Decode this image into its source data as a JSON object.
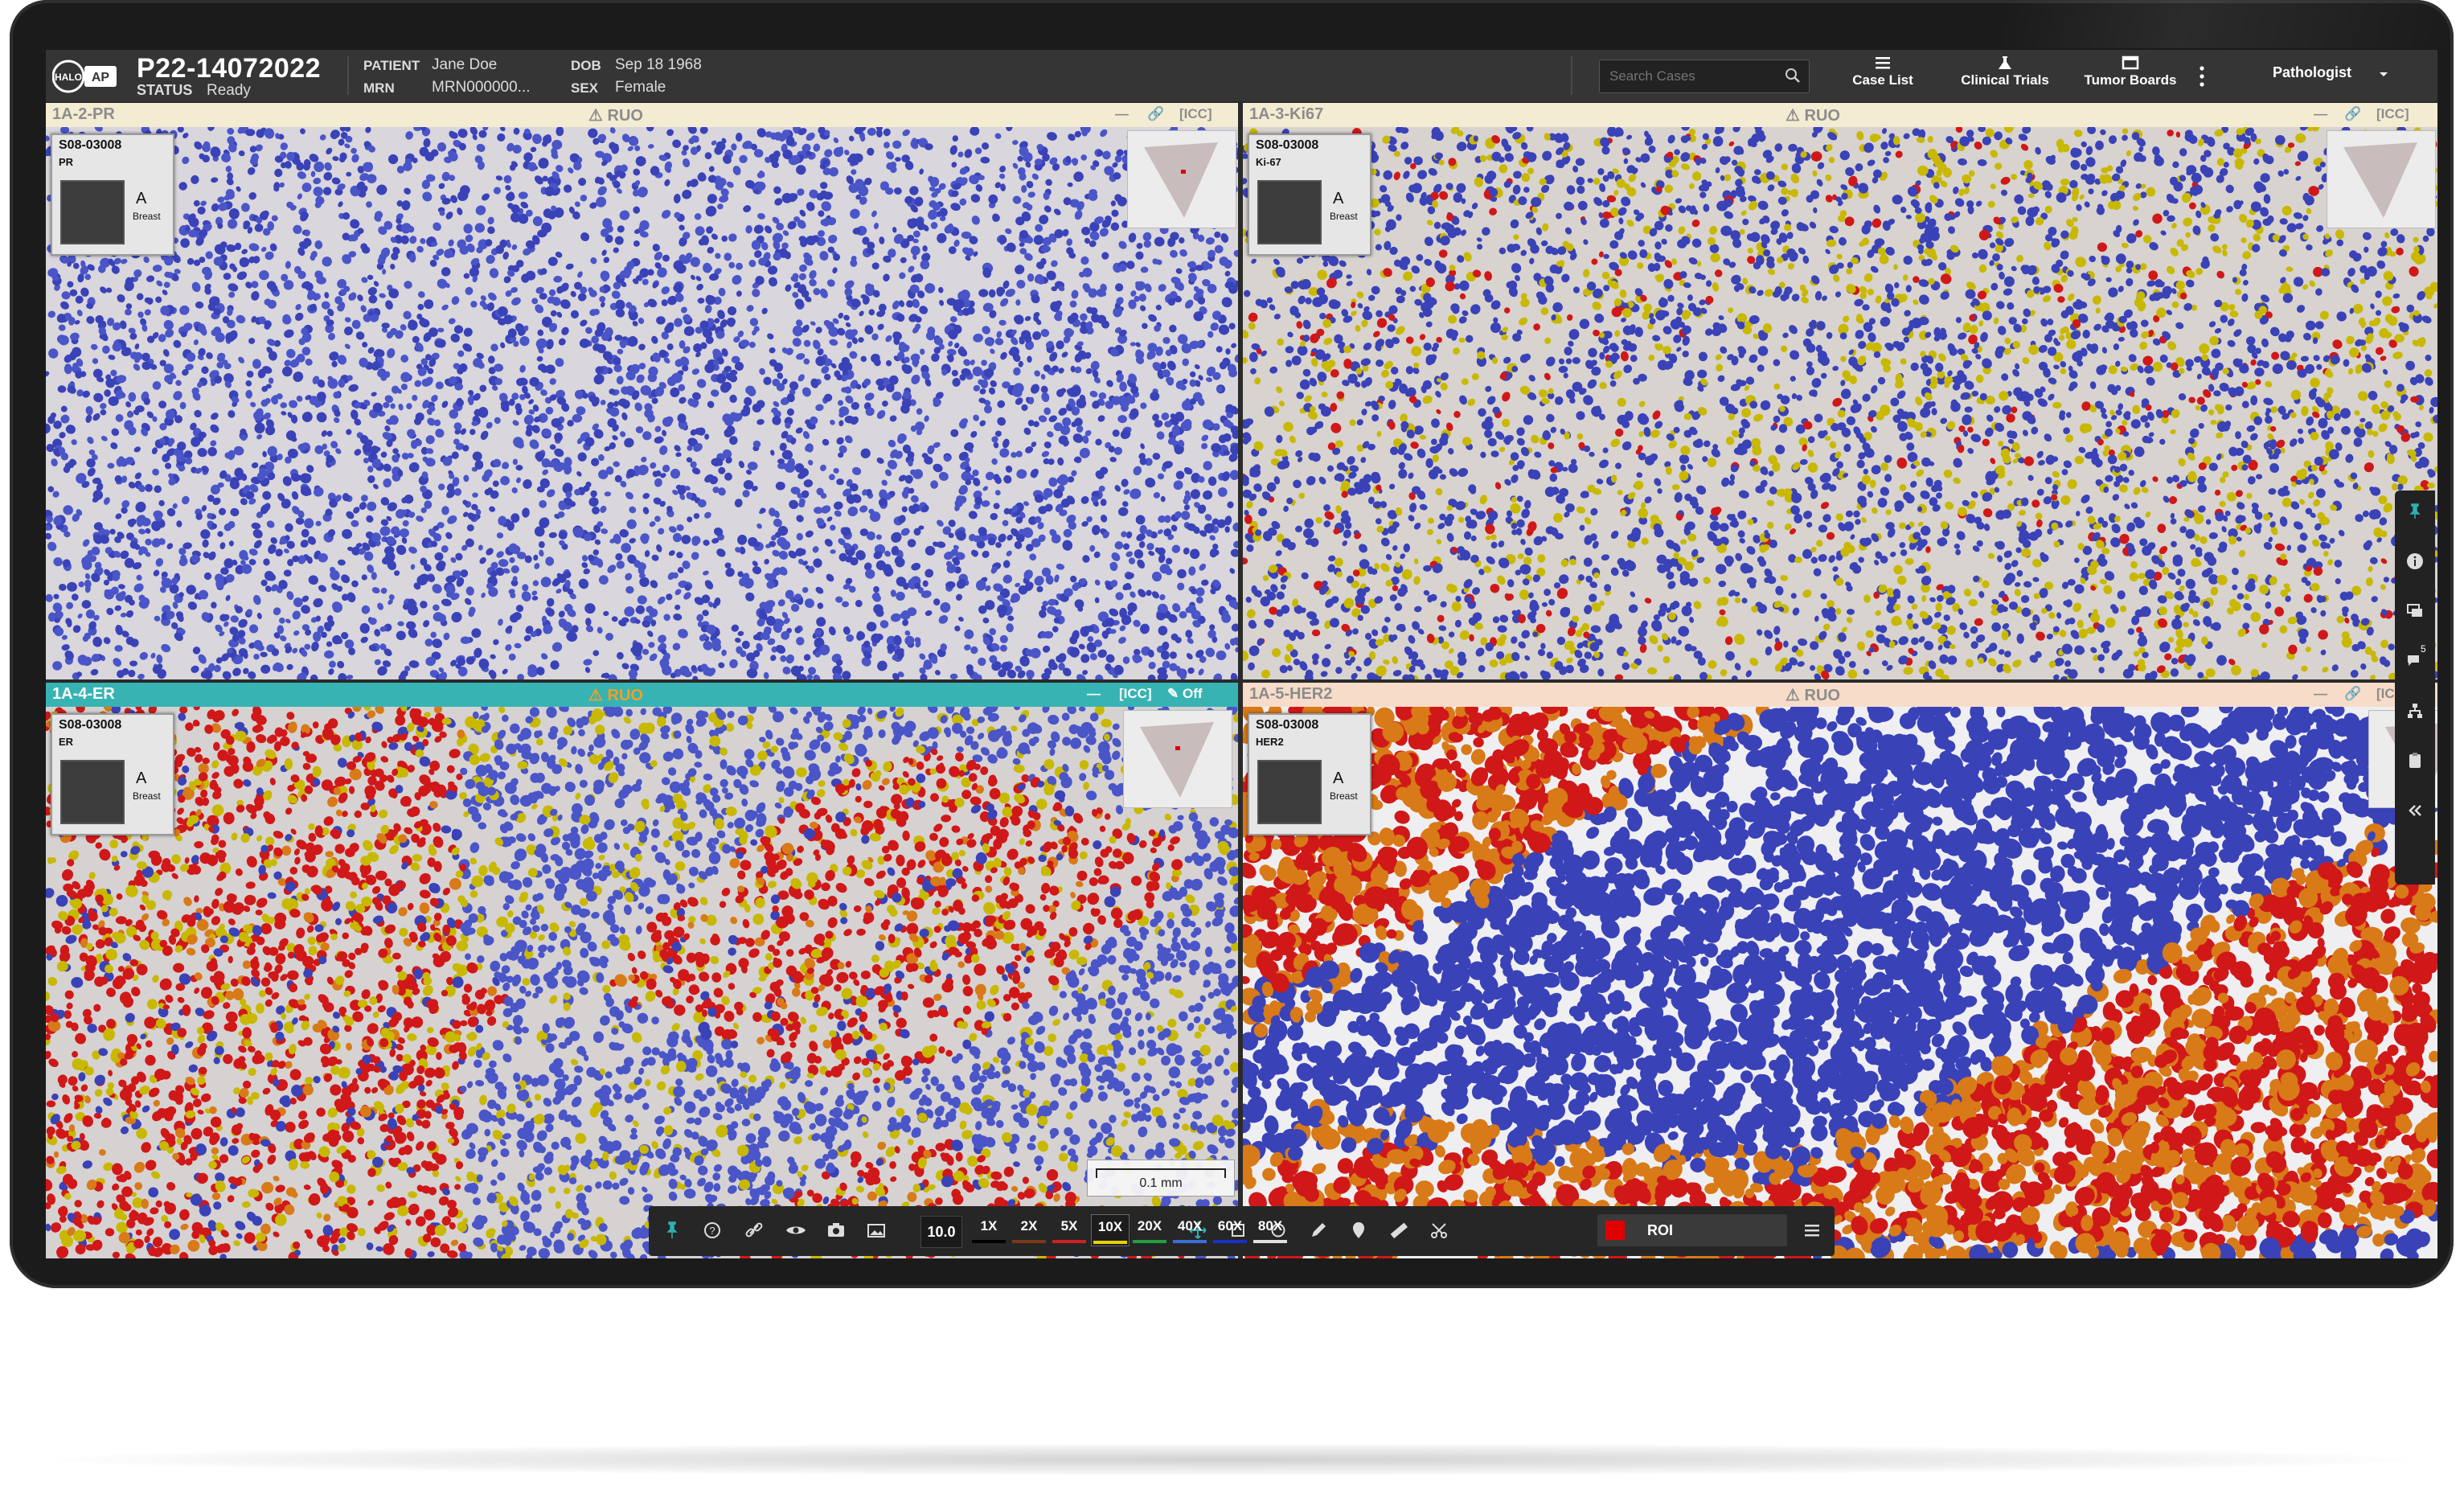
{
  "header": {
    "logo_main": "HALO",
    "logo_sub": "AP",
    "case_id": "P22-14072022",
    "status_label": "STATUS",
    "status_value": "Ready",
    "patient_label": "PATIENT",
    "patient_value": "Jane Doe",
    "mrn_label": "MRN",
    "mrn_value": "MRN000000...",
    "dob_label": "DOB",
    "dob_value": "Sep 18 1968",
    "sex_label": "SEX",
    "sex_value": "Female",
    "search_placeholder": "Search Cases",
    "nav": [
      {
        "label": "Case List",
        "icon": "list-icon"
      },
      {
        "label": "Clinical Trials",
        "icon": "flask-icon"
      },
      {
        "label": "Tumor Boards",
        "icon": "board-icon"
      }
    ],
    "role": "Pathologist"
  },
  "viewports": [
    {
      "name": "1A-2-PR",
      "ruo": "RUO",
      "icc": "[ICC]",
      "label_id": "S08-03008",
      "stain": "PR",
      "block": "A",
      "organ": "Breast",
      "header_color": "#f3ecd2"
    },
    {
      "name": "1A-3-Ki67",
      "ruo": "RUO",
      "icc": "[ICC]",
      "label_id": "S08-03008",
      "stain": "Ki-67",
      "block": "A",
      "organ": "Breast",
      "header_color": "#f3ecd2"
    },
    {
      "name": "1A-4-ER",
      "ruo": "RUO",
      "icc": "[ICC]",
      "off": "Off",
      "label_id": "S08-03008",
      "stain": "ER",
      "block": "A",
      "organ": "Breast",
      "header_color": "#37b3b3"
    },
    {
      "name": "1A-5-HER2",
      "ruo": "RUO",
      "icc": "[ICC]",
      "label_id": "S08-03008",
      "stain": "HER2",
      "block": "A",
      "organ": "Breast",
      "header_color": "#f6dcc9"
    }
  ],
  "scale": "0.1 mm",
  "toolbar": {
    "zoom_value": "10.0",
    "zoom_levels": [
      {
        "label": "1X",
        "color": "#000000",
        "active": false
      },
      {
        "label": "2X",
        "color": "#7a3a18",
        "active": false
      },
      {
        "label": "5X",
        "color": "#d02020",
        "active": false
      },
      {
        "label": "10X",
        "color": "#e8d000",
        "active": true
      },
      {
        "label": "20X",
        "color": "#20a040",
        "active": false
      },
      {
        "label": "40X",
        "color": "#3a6fd8",
        "active": false
      },
      {
        "label": "60X",
        "color": "#1830c8",
        "active": false
      },
      {
        "label": "80X",
        "color": "#e0e0e0",
        "active": false
      }
    ],
    "annotation_label": "ROI",
    "annotation_color": "#e00000"
  },
  "rail": {
    "badge": "5"
  }
}
